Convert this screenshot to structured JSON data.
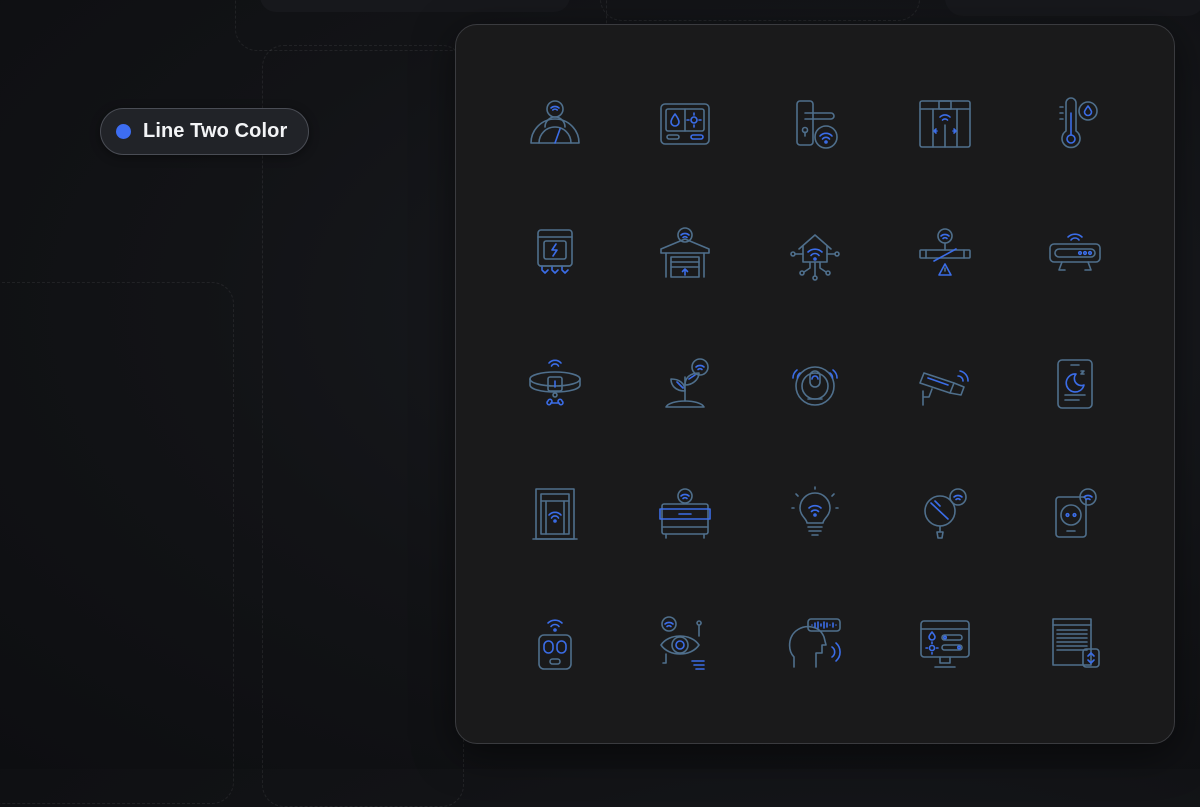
{
  "badge": {
    "label": "Line Two Color",
    "dot_color": "#3d6df2"
  },
  "colors": {
    "line_primary": "#4f6f8c",
    "line_accent": "#3b6de8"
  },
  "icons": [
    "smart-meter-person-icon",
    "thermostat-panel-icon",
    "smart-door-handle-icon",
    "smart-sliding-door-icon",
    "smart-thermometer-icon",
    "smart-water-heater-icon",
    "smart-garage-door-icon",
    "smart-home-network-icon",
    "smart-water-valve-icon",
    "smart-router-icon",
    "smart-pet-collar-icon",
    "smart-plant-icon",
    "robot-vacuum-icon",
    "security-camera-icon",
    "sleep-app-phone-icon",
    "smart-window-icon",
    "smart-drawer-icon",
    "smart-bulb-icon",
    "smart-mirror-icon",
    "smart-socket-icon",
    "smart-remote-icon",
    "smart-eye-tracking-icon",
    "voice-assistant-icon",
    "smart-home-monitor-icon",
    "smart-blinds-icon"
  ]
}
